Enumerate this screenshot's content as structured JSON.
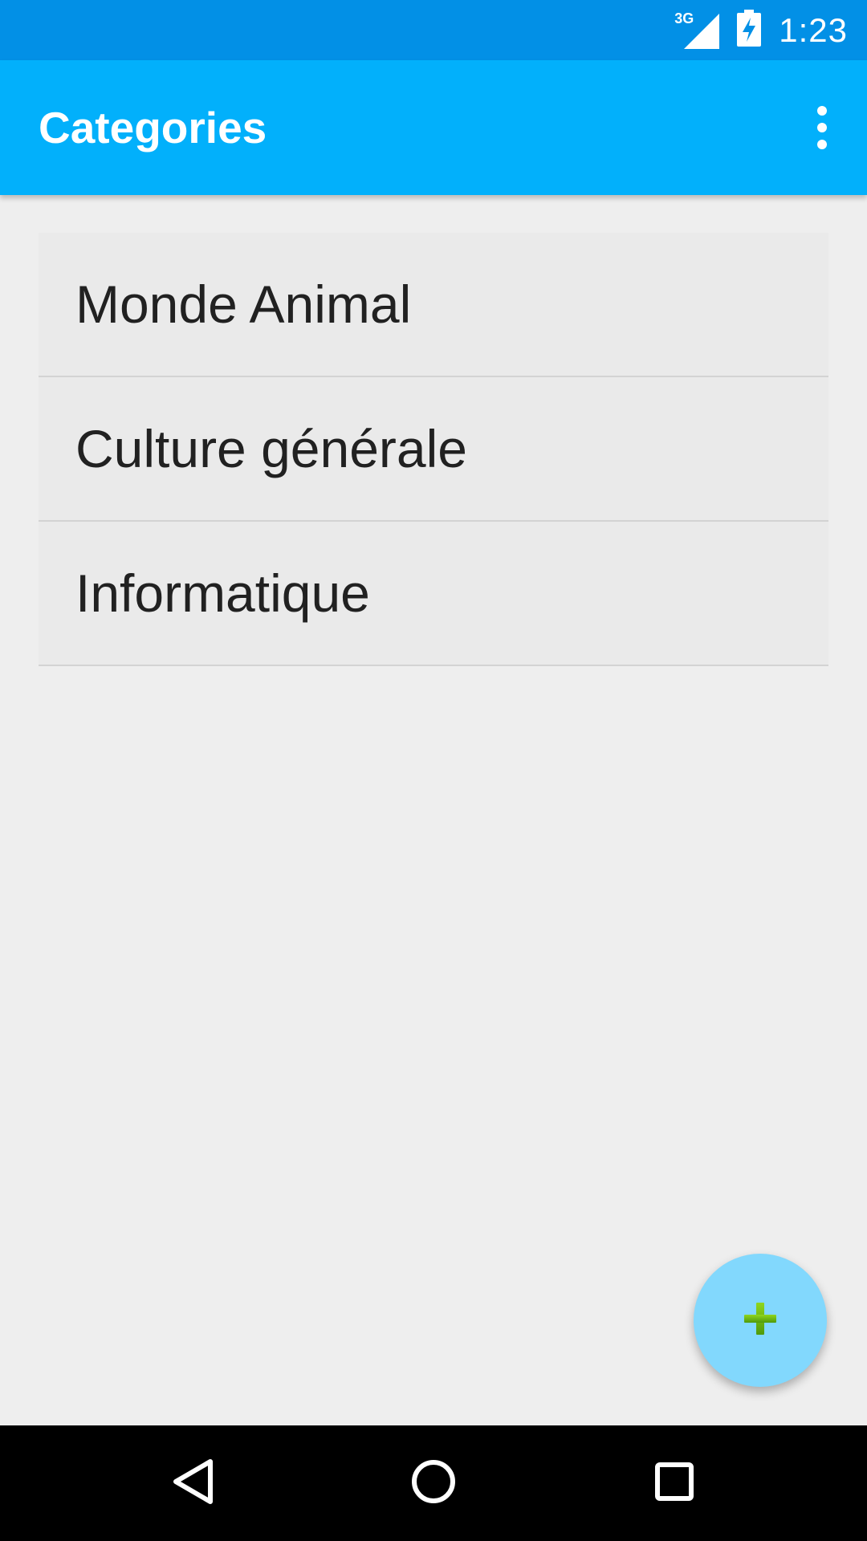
{
  "status_bar": {
    "network_label": "3G",
    "time": "1:23",
    "icons": [
      "signal-icon",
      "battery-charging-icon"
    ]
  },
  "app_bar": {
    "title": "Categories",
    "menu_icon": "overflow-menu-icon"
  },
  "categories": [
    {
      "label": "Monde Animal"
    },
    {
      "label": "Culture générale"
    },
    {
      "label": "Informatique"
    }
  ],
  "fab": {
    "icon": "add-icon",
    "color": "#82d8fd",
    "icon_color": "#66bb10"
  },
  "nav_bar": {
    "buttons": [
      "back-icon",
      "home-icon",
      "recents-icon"
    ]
  },
  "colors": {
    "status_bar": "#0290e6",
    "app_bar": "#02b0fb",
    "background": "#eeeeee",
    "list_item": "#eaeaea"
  }
}
